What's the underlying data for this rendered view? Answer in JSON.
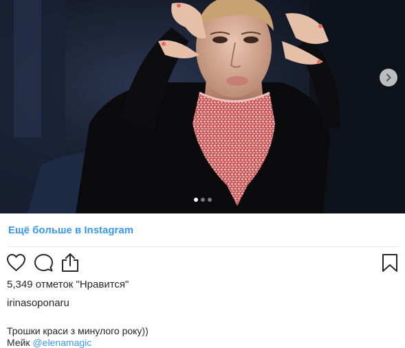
{
  "post": {
    "carousel": {
      "slide_count": 3,
      "active_slide": 1
    },
    "more_link": "Ещё больше в Instagram",
    "actions": {
      "like_icon": "heart-icon",
      "comment_icon": "comment-icon",
      "share_icon": "share-icon",
      "save_icon": "bookmark-icon",
      "next_icon": "chevron-right-icon"
    },
    "likes_text": "5,349 отметок \"Нравится\"",
    "username": "irinasoponaru",
    "caption_line1": "Трошки краси з минулого року))",
    "caption_line2_prefix": "Мейк ",
    "caption_mention": "@elenamagic"
  },
  "colors": {
    "link": "#3897f0",
    "text": "#262626",
    "divider": "#e6e6e6"
  }
}
